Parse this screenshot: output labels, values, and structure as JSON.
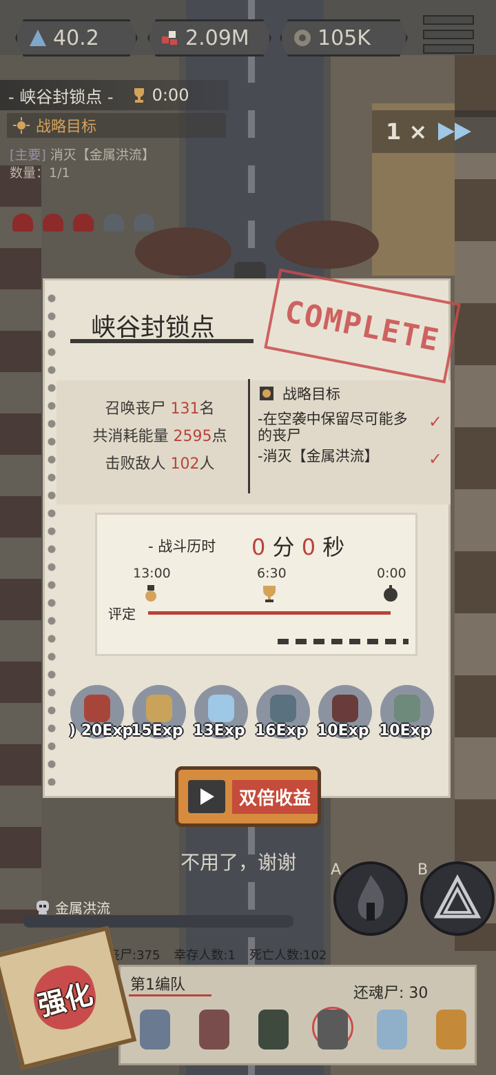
{
  "hud": {
    "resources": [
      {
        "icon": "energy-triangle-icon",
        "value": "40.2"
      },
      {
        "icon": "brain-cluster-icon",
        "value": "2.09M"
      },
      {
        "icon": "gear-coin-icon",
        "value": "105K"
      }
    ],
    "menu_icon": "hamburger-menu-icon",
    "mission_name": "- 峡谷封锁点 -",
    "mission_timer": "0:00",
    "objective_header": "战略目标",
    "objective_tag": "[主要]",
    "objective_text": "消灭【金属洪流】",
    "objective_count": "数量：1/1",
    "speed_label": "1 ×"
  },
  "result": {
    "title": "峡谷封锁点",
    "stamp": "COMPLETE",
    "stats": {
      "summon_prefix": "召唤丧尸 ",
      "summon_value": "131",
      "summon_unit": "名",
      "energy_prefix": "共消耗能量 ",
      "energy_value": "2595",
      "energy_unit": "点",
      "defeat_prefix": "击败敌人 ",
      "defeat_value": "102",
      "defeat_unit": "人"
    },
    "goals_header": "战略目标",
    "goals": [
      {
        "text": "-在空袭中保留尽可能多的丧尸",
        "check": "✓"
      },
      {
        "text": "-消灭【金属洪流】",
        "check": "✓"
      }
    ],
    "battle": {
      "label": "- 战斗历时",
      "minutes": "0",
      "min_unit": "分",
      "seconds": "0",
      "sec_unit": "秒",
      "ticks": [
        "13:00",
        "6:30",
        "0:00"
      ],
      "rating_label": "评定"
    },
    "units": [
      {
        "exp": ") 20Exp",
        "color": "#a8453a"
      },
      {
        "exp": "15Exp",
        "color": "#c9a35a"
      },
      {
        "exp": "13Exp",
        "color": "#9fc7e6"
      },
      {
        "exp": "16Exp",
        "color": "#5a7280"
      },
      {
        "exp": "10Exp",
        "color": "#6a3b3b"
      },
      {
        "exp": "10Exp",
        "color": "#6d8a7a"
      }
    ],
    "double_button": "双倍收益",
    "no_thanks": "不用了，谢谢"
  },
  "skills": {
    "a_key": "A",
    "b_key": "B"
  },
  "bottom": {
    "boss_name": "金属洪流",
    "zombies": "丧尸:375",
    "survivors": "幸存人数:1",
    "dead": "死亡人数:102",
    "squad_name": "第1编队",
    "souls": "还魂尸: 30",
    "enhance": "强化",
    "members": [
      "#6a7a90",
      "#7a4d4d",
      "#3f4a3f",
      "#5a5a5a",
      "#8fb0c8",
      "#c48a3a"
    ]
  },
  "colors": {
    "accent_red": "#b8433a",
    "stamp_red": "#c94c4c",
    "button_orange": "#d68b3e"
  }
}
